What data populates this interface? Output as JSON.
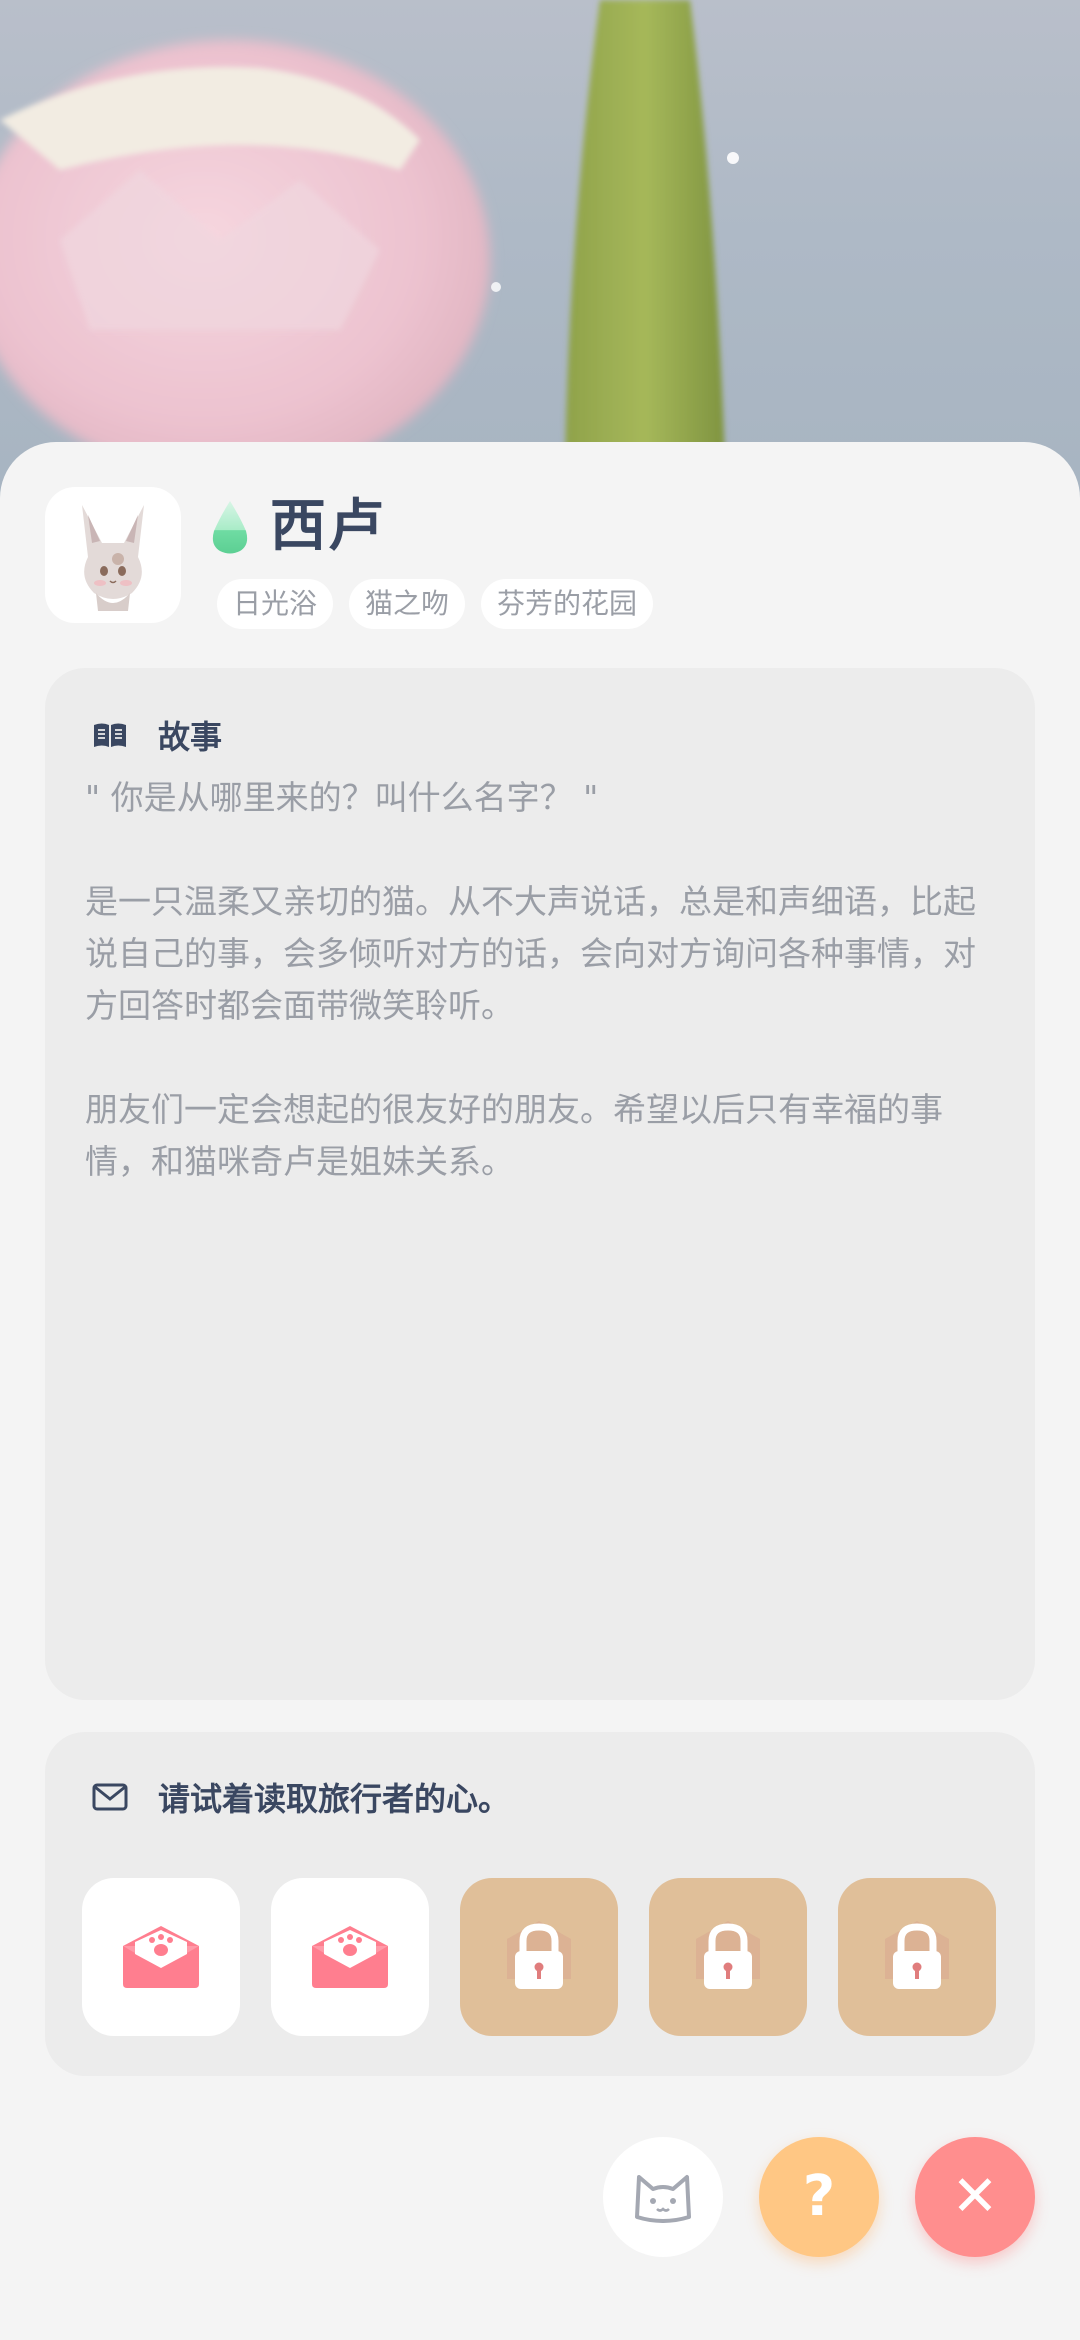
{
  "character": {
    "name": "西卢",
    "tags": [
      "日光浴",
      "猫之吻",
      "芬芳的花园"
    ]
  },
  "story": {
    "title": "故事",
    "paragraphs": [
      "\" 你是从哪里来的？叫什么名字？ \"",
      "是一只温柔又亲切的猫。从不大声说话，总是和声细语，比起说自己的事，会多倾听对方的话，会向对方询问各种事情，对方回答时都会面带微笑聆听。",
      "朋友们一定会想起的很友好的朋友。希望以后只有幸福的事情，和猫咪奇卢是姐妹关系。"
    ]
  },
  "hearts": {
    "title": "请试着读取旅行者的心。",
    "slots": [
      {
        "state": "unlocked",
        "icon": "paw-envelope-icon"
      },
      {
        "state": "unlocked",
        "icon": "paw-envelope-icon"
      },
      {
        "state": "locked",
        "icon": "lock-icon"
      },
      {
        "state": "locked",
        "icon": "lock-icon"
      },
      {
        "state": "locked",
        "icon": "lock-icon"
      }
    ]
  },
  "buttons": {
    "help_label": "?",
    "close_label": "✕"
  },
  "colors": {
    "title_text": "#3a4761",
    "body_text": "#9a9ea6",
    "help_button": "#ffc784",
    "close_button": "#ff8e8e",
    "locked_slot": "#e0bf99",
    "envelope": "#ff7e8f"
  }
}
